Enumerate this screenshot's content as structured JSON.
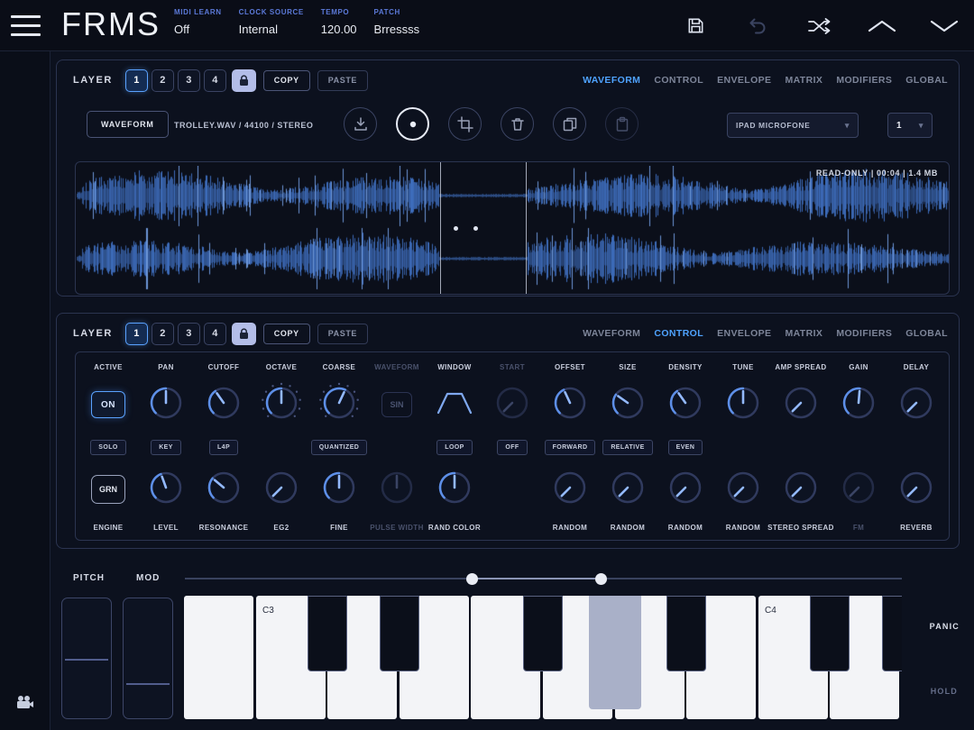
{
  "topbar": {
    "logo": "FRMS",
    "fields": [
      {
        "label": "MIDI LEARN",
        "value": "Off"
      },
      {
        "label": "CLOCK SOURCE",
        "value": "Internal"
      },
      {
        "label": "TEMPO",
        "value": "120.00"
      },
      {
        "label": "PATCH",
        "value": "Brressss"
      }
    ],
    "icons": [
      "save-icon",
      "undo-icon",
      "randomize-icon",
      "chevron-up-icon",
      "chevron-down-icon"
    ]
  },
  "tabs": [
    "WAVEFORM",
    "CONTROL",
    "ENVELOPE",
    "MATRIX",
    "MODIFIERS",
    "GLOBAL"
  ],
  "layer_header": {
    "label": "LAYER",
    "layers": [
      "1",
      "2",
      "3",
      "4"
    ],
    "active_layer": "1",
    "copy": "COPY",
    "paste": "PASTE"
  },
  "waveform_panel": {
    "active_tab": "WAVEFORM",
    "toolbar": {
      "waveform_button": "WAVEFORM",
      "file_info": "TROLLEY.WAV / 44100 / STEREO",
      "icons": [
        {
          "name": "import-icon"
        },
        {
          "name": "record-icon",
          "state": "active"
        },
        {
          "name": "crop-icon"
        },
        {
          "name": "trash-icon"
        },
        {
          "name": "copy-icon"
        },
        {
          "name": "paste-icon",
          "state": "disabled"
        }
      ],
      "input_select": "IPAD MICROFONE",
      "channel_select": "1"
    },
    "display": {
      "status": "READ-ONLY  |  00:04  |  1.4 MB",
      "cursors": [
        0.417,
        0.515
      ],
      "marker_dots": [
        0.433,
        0.456
      ],
      "waveform_color": "#4274c8",
      "channels": 2
    }
  },
  "control_panel": {
    "active_tab": "CONTROL",
    "columns": [
      {
        "top_label": "ACTIVE",
        "top": {
          "type": "button",
          "label": "ON",
          "style": "active"
        },
        "mid": "SOLO",
        "bottom": {
          "type": "button",
          "label": "GRN",
          "style": "outline"
        },
        "bottom_label": "ENGINE"
      },
      {
        "top_label": "PAN",
        "top": {
          "type": "knob",
          "angle": 0
        },
        "mid": "KEY",
        "bottom": {
          "type": "knob",
          "angle": -20
        },
        "bottom_label": "LEVEL"
      },
      {
        "top_label": "CUTOFF",
        "top": {
          "type": "knob",
          "angle": -35
        },
        "mid": "L4P",
        "bottom": {
          "type": "knob",
          "angle": -50
        },
        "bottom_label": "RESONANCE"
      },
      {
        "top_label": "OCTAVE",
        "top": {
          "type": "knob",
          "angle": 0,
          "ticks": true
        },
        "bottom": {
          "type": "knob",
          "angle": -135
        },
        "bottom_label": "EG2"
      },
      {
        "top_label": "COARSE",
        "top": {
          "type": "knob",
          "angle": 25,
          "ticks": true
        },
        "mid": "QUANTIZED",
        "bottom": {
          "type": "knob",
          "angle": 0
        },
        "bottom_label": "FINE"
      },
      {
        "top_label": "WAVEFORM",
        "top_dim": true,
        "top": {
          "type": "button",
          "label": "SIN",
          "style": "dim"
        },
        "bottom": {
          "type": "knob",
          "angle": 0,
          "dim": true
        },
        "bottom_label": "PULSE WIDTH",
        "bottom_dim": true
      },
      {
        "top_label": "WINDOW",
        "top": {
          "type": "window"
        },
        "mid": "LOOP",
        "bottom": {
          "type": "knob",
          "angle": 0
        },
        "bottom_label": "RAND COLOR"
      },
      {
        "top_label": "START",
        "top_dim": true,
        "top": {
          "type": "knob",
          "angle": -135,
          "dim": true
        },
        "mid": "OFF",
        "bottom": null,
        "bottom_label": ""
      },
      {
        "top_label": "OFFSET",
        "top": {
          "type": "knob",
          "angle": -25
        },
        "mid": "FORWARD",
        "bottom": {
          "type": "knob",
          "angle": -135
        },
        "bottom_label": "RANDOM"
      },
      {
        "top_label": "SIZE",
        "top": {
          "type": "knob",
          "angle": -55
        },
        "mid": "RELATIVE",
        "bottom": {
          "type": "knob",
          "angle": -135
        },
        "bottom_label": "RANDOM"
      },
      {
        "top_label": "DENSITY",
        "top": {
          "type": "knob",
          "angle": -35
        },
        "mid": "EVEN",
        "bottom": {
          "type": "knob",
          "angle": -135
        },
        "bottom_label": "RANDOM"
      },
      {
        "top_label": "TUNE",
        "top": {
          "type": "knob",
          "angle": 0
        },
        "bottom": {
          "type": "knob",
          "angle": -135
        },
        "bottom_label": "RANDOM"
      },
      {
        "top_label": "AMP SPREAD",
        "top": {
          "type": "knob",
          "angle": -135
        },
        "bottom": {
          "type": "knob",
          "angle": -135
        },
        "bottom_label": "STEREO SPREAD"
      },
      {
        "top_label": "GAIN",
        "top": {
          "type": "knob",
          "angle": 5
        },
        "bottom": {
          "type": "knob",
          "angle": -135,
          "dim": true
        },
        "bottom_label": "FM",
        "bottom_dim": true
      },
      {
        "top_label": "DELAY",
        "top": {
          "type": "knob",
          "angle": -135
        },
        "bottom": {
          "type": "knob",
          "angle": -135
        },
        "bottom_label": "REVERB"
      }
    ]
  },
  "keyboard": {
    "pitch_label": "PITCH",
    "mod_label": "MOD",
    "panic_label": "PANIC",
    "hold_label": "HOLD",
    "range_handles": [
      0.4,
      0.58
    ],
    "pitch_wheel": 0.5,
    "mod_wheel": 0.28,
    "white_keys": [
      {
        "note": "B2"
      },
      {
        "note": "C3",
        "label": "C3"
      },
      {
        "note": "D3"
      },
      {
        "note": "E3"
      },
      {
        "note": "F3"
      },
      {
        "note": "G3"
      },
      {
        "note": "A3"
      },
      {
        "note": "B3"
      },
      {
        "note": "C4",
        "label": "C4"
      },
      {
        "note": "D4"
      }
    ],
    "black_keys": [
      {
        "note": "C#3",
        "boundary": 2
      },
      {
        "note": "D#3",
        "boundary": 3
      },
      {
        "note": "F#3",
        "boundary": 5
      },
      {
        "note": "G#3",
        "boundary": 6,
        "pressed": true
      },
      {
        "note": "A#3",
        "boundary": 7
      },
      {
        "note": "C#4",
        "boundary": 9
      },
      {
        "note": "D#4",
        "boundary": 10
      }
    ],
    "pressed_note": "G#3"
  },
  "colors": {
    "accent": "#4fa3ff",
    "panel_border": "#2b3450",
    "background": "#0c111e",
    "waveform": "#4274c8",
    "pressed_key": "#a9b0c8"
  }
}
